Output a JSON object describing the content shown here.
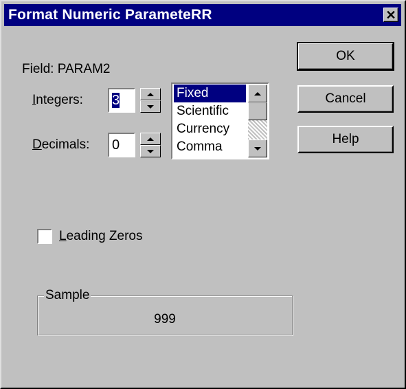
{
  "window": {
    "title": "Format Numeric ParameteRR"
  },
  "field": {
    "label": "Field: PARAM2"
  },
  "integers": {
    "label_accel": "I",
    "label_rest": "ntegers:",
    "value": "3"
  },
  "decimals": {
    "label_accel": "D",
    "label_rest": "ecimals:",
    "value": "0"
  },
  "format_list": {
    "items": [
      "Fixed",
      "Scientific",
      "Currency",
      "Comma"
    ],
    "selected": "Fixed"
  },
  "buttons": {
    "ok": "OK",
    "cancel": "Cancel",
    "help": "Help"
  },
  "leading_zeros": {
    "label_accel": "L",
    "label_rest": "eading Zeros",
    "checked": false
  },
  "sample": {
    "title": "Sample",
    "value": "999"
  },
  "icons": {
    "close": "close-icon",
    "spin_up": "arrow-up-icon",
    "spin_down": "arrow-down-icon"
  }
}
